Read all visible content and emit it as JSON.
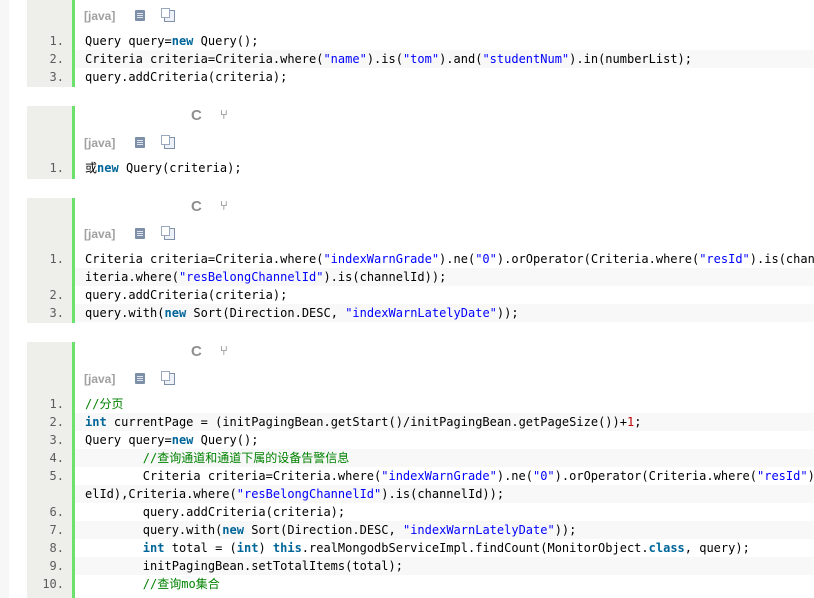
{
  "toolbar": {
    "language_label": "[java]",
    "view_source_icon": "view-source-icon",
    "copy_icon": "copy-icon",
    "action_c_label": "C",
    "action_fork_label": "⑂"
  },
  "snippets": [
    {
      "has_actions": false,
      "lines": [
        {
          "num": "1.",
          "text": "Query query=new Query();"
        },
        {
          "num": "2.",
          "text": "Criteria criteria=Criteria.where(\"name\").is(\"tom\").and(\"studentNum\").in(numberList);"
        },
        {
          "num": "3.",
          "text": "query.addCriteria(criteria);"
        }
      ]
    },
    {
      "has_actions": true,
      "lines": [
        {
          "num": "1.",
          "text": "或new Query(criteria);"
        }
      ]
    },
    {
      "has_actions": true,
      "lines": [
        {
          "num": "1.",
          "text": "Criteria criteria=Criteria.where(\"indexWarnGrade\").ne(\"0\").orOperator(Criteria.where(\"resId\").is(channelId),Cr"
        },
        {
          "num": "",
          "text": "iteria.where(\"resBelongChannelId\").is(channelId));"
        },
        {
          "num": "2.",
          "text": "query.addCriteria(criteria);"
        },
        {
          "num": "3.",
          "text": "query.with(new Sort(Direction.DESC, \"indexWarnLatelyDate\"));"
        }
      ]
    },
    {
      "has_actions": true,
      "lines": [
        {
          "num": "1.",
          "text": "//分页"
        },
        {
          "num": "2.",
          "text": "int currentPage = (initPagingBean.getStart()/initPagingBean.getPageSize())+1;"
        },
        {
          "num": "3.",
          "text": "Query query=new Query();"
        },
        {
          "num": "4.",
          "text": "        //查询通道和通道下属的设备告警信息"
        },
        {
          "num": "5.",
          "text": "        Criteria criteria=Criteria.where(\"indexWarnGrade\").ne(\"0\").orOperator(Criteria.where(\"resId\").is(chann"
        },
        {
          "num": "",
          "text": "elId),Criteria.where(\"resBelongChannelId\").is(channelId));"
        },
        {
          "num": "6.",
          "text": "        query.addCriteria(criteria);"
        },
        {
          "num": "7.",
          "text": "        query.with(new Sort(Direction.DESC, \"indexWarnLatelyDate\"));"
        },
        {
          "num": "8.",
          "text": "        int total = (int) this.realMongodbServiceImpl.findCount(MonitorObject.class, query);"
        },
        {
          "num": "9.",
          "text": "        initPagingBean.setTotalItems(total);"
        },
        {
          "num": "10.",
          "text": "        //查询mo集合"
        }
      ]
    }
  ]
}
